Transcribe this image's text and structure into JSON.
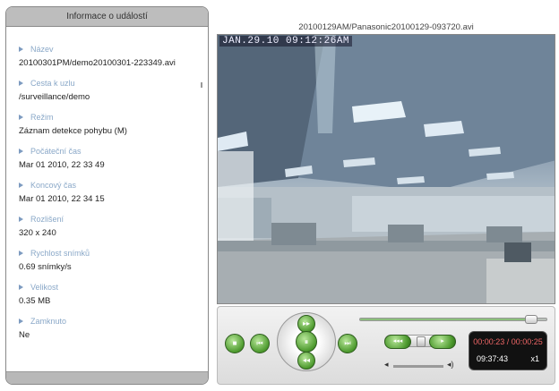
{
  "info_panel": {
    "title": "Informace o událostí",
    "fields": [
      {
        "label": "Název",
        "value": "20100301PM/demo20100301-223349.avi"
      },
      {
        "label": "Cesta k uzlu",
        "value": "/surveillance/demo"
      },
      {
        "label": "Režim",
        "value": "Záznam detekce pohybu (M)"
      },
      {
        "label": "Počáteční čas",
        "value": "Mar 01 2010, 22 33 49"
      },
      {
        "label": "Koncový čas",
        "value": "Mar 01 2010, 22 34 15"
      },
      {
        "label": "Rozlišení",
        "value": "320 x 240"
      },
      {
        "label": "Rychlost snímků",
        "value": "0.69 snímky/s"
      },
      {
        "label": "Velikost",
        "value": "0.35 MB"
      },
      {
        "label": "Zamknuto",
        "value": "Ne"
      }
    ]
  },
  "video": {
    "file_title": "20100129AM/Panasonic20100129-093720.avi",
    "timestamp": "JAN.29.10 09:12:26AM"
  },
  "controls": {
    "stop_icon": "■",
    "prev_icon": "⏮",
    "next_icon": "⏭",
    "play_pause_icon": "⏸",
    "forward_icon": "▸▸",
    "rewind_icon": "◂◂",
    "slower_icon": "◂◂◂",
    "faster_icon": "▸",
    "seek_position": 0.92,
    "elapsed": "00:00:23 / 00:00:25",
    "clock": "09:37:43",
    "speed": "x1"
  },
  "colors": {
    "accent_green": "#4d9a2e",
    "panel_header": "#bdbdbd",
    "label_blue": "#8aa8c8"
  }
}
